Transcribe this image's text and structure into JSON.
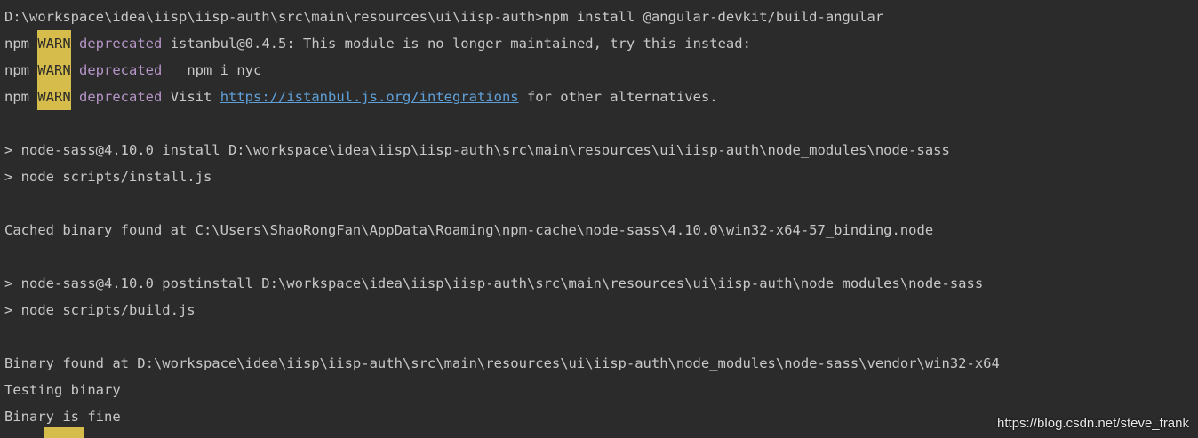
{
  "terminal": {
    "cmd_line": "D:\\workspace\\idea\\iisp\\iisp-auth\\src\\main\\resources\\ui\\iisp-auth>npm install @angular-devkit/build-angular",
    "npm": "npm",
    "warn": "WARN",
    "deprecated": "deprecated",
    "warn1_msg": "istanbul@0.4.5: This module is no longer maintained, try this instead:",
    "warn2_msg": "  npm i nyc",
    "warn3_pre": "Visit ",
    "warn3_link": "https://istanbul.js.org/integrations",
    "warn3_post": " for other alternatives.",
    "install_line": "> node-sass@4.10.0 install D:\\workspace\\idea\\iisp\\iisp-auth\\src\\main\\resources\\ui\\iisp-auth\\node_modules\\node-sass",
    "install_script": "> node scripts/install.js",
    "cached_line": "Cached binary found at C:\\Users\\ShaoRongFan\\AppData\\Roaming\\npm-cache\\node-sass\\4.10.0\\win32-x64-57_binding.node",
    "postinstall_line": "> node-sass@4.10.0 postinstall D:\\workspace\\idea\\iisp\\iisp-auth\\src\\main\\resources\\ui\\iisp-auth\\node_modules\\node-sass",
    "build_script": "> node scripts/build.js",
    "binary_found_line": "Binary found at D:\\workspace\\idea\\iisp\\iisp-auth\\src\\main\\resources\\ui\\iisp-auth\\node_modules\\node-sass\\vendor\\win32-x64",
    "testing_line": "Testing binary",
    "fine_line": "Binary is fine"
  },
  "watermark": "https://blog.csdn.net/steve_frank",
  "colors": {
    "background": "#2b2b2b",
    "text": "#c8c8c8",
    "warn_bg": "#d6bc4a",
    "deprecated": "#b695c8",
    "link": "#5fa0d8"
  }
}
